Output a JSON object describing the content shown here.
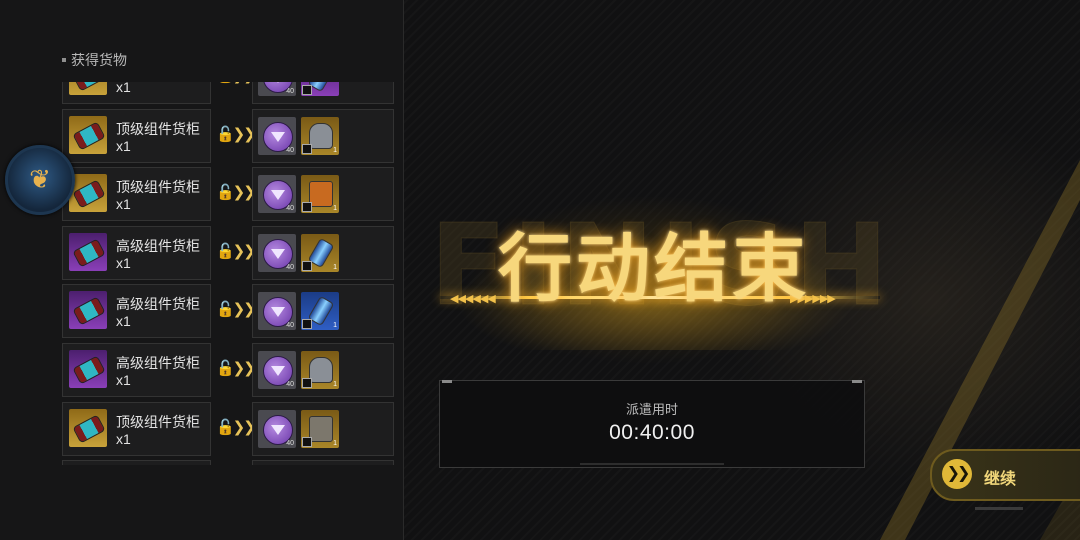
{
  "left_panel": {
    "header": "获得货物",
    "items": [
      {
        "name": "",
        "qty": "x1",
        "rarity": "gold",
        "reward_item": "purple",
        "reward_shape": "tube",
        "reward_count": "40",
        "reward_qty": ""
      },
      {
        "name": "顶级组件货柜",
        "qty": "x1",
        "rarity": "gold",
        "reward_item": "gold",
        "reward_shape": "round",
        "reward_count": "40",
        "reward_qty": "1"
      },
      {
        "name": "顶级组件货柜",
        "qty": "x1",
        "rarity": "gold",
        "reward_item": "gold",
        "reward_shape": "orange",
        "reward_count": "40",
        "reward_qty": "1"
      },
      {
        "name": "高级组件货柜",
        "qty": "x1",
        "rarity": "purple",
        "reward_item": "gold",
        "reward_shape": "tube",
        "reward_count": "40",
        "reward_qty": "1"
      },
      {
        "name": "高级组件货柜",
        "qty": "x1",
        "rarity": "purple",
        "reward_item": "blue",
        "reward_shape": "tube",
        "reward_count": "40",
        "reward_qty": "1"
      },
      {
        "name": "高级组件货柜",
        "qty": "x1",
        "rarity": "purple",
        "reward_item": "gold",
        "reward_shape": "round",
        "reward_count": "40",
        "reward_qty": "1"
      },
      {
        "name": "顶级组件货柜",
        "qty": "x1",
        "rarity": "gold",
        "reward_item": "gold",
        "reward_shape": "gear",
        "reward_count": "40",
        "reward_qty": "1"
      }
    ]
  },
  "title": {
    "watermark": "FINISH",
    "main": "行动结束"
  },
  "dispatch": {
    "label": "派遣用时",
    "time": "00:40:00"
  },
  "continue": {
    "label": "继续",
    "icon": "double-chevron-right-icon"
  },
  "colors": {
    "accent_gold": "#e0b838",
    "title_glow": "#ffb830",
    "rarity_gold": "#c8a23a",
    "rarity_purple": "#8a3fb8",
    "rarity_blue": "#2f5ec4"
  }
}
